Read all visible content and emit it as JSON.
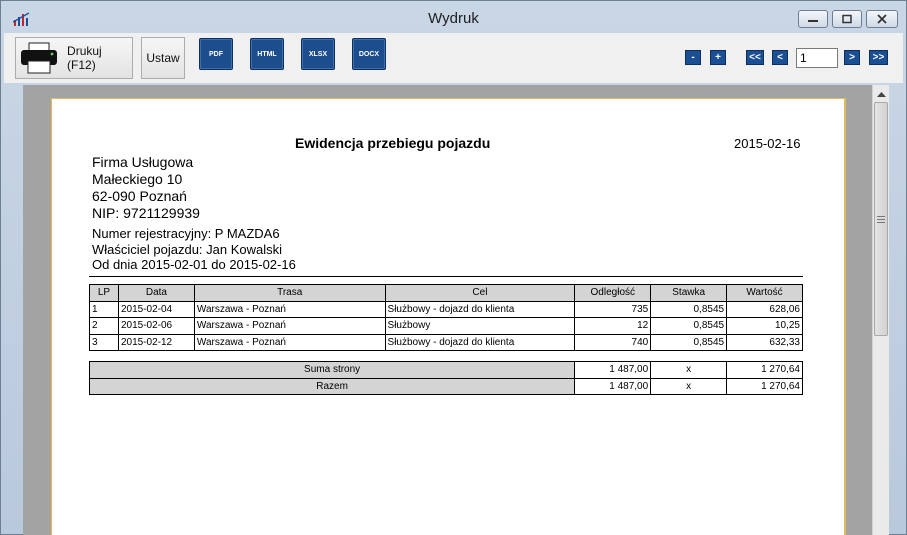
{
  "window": {
    "title": "Wydruk"
  },
  "toolbar": {
    "print_label": "Drukuj (F12)",
    "setup_label": "Ustaw",
    "exports": [
      "PDF",
      "HTML",
      "XLSX",
      "DOCX"
    ],
    "zoom_out": "-",
    "zoom_in": "+",
    "first_page": "<<",
    "prev_page": "<",
    "next_page": ">",
    "last_page": ">>",
    "page_value": "1"
  },
  "report": {
    "title": "Ewidencja przebiegu pojazdu",
    "date": "2015-02-16",
    "company": {
      "name": "Firma Usługowa",
      "street": "Małeckiego 10",
      "city": "62-090 Poznań",
      "nip": "NIP: 9721129939"
    },
    "vehicle": {
      "registration": "Numer rejestracyjny: P MAZDA6",
      "owner": "Właściciel pojazdu: Jan Kowalski",
      "period": "Od dnia 2015-02-01 do 2015-02-16"
    },
    "columns": [
      "LP",
      "Data",
      "Trasa",
      "Cel",
      "Odległość",
      "Stawka",
      "Wartość"
    ],
    "rows": [
      [
        "1",
        "2015-02-04",
        "Warszawa - Poznań",
        "Służbowy - dojazd do klienta",
        "735",
        "0,8545",
        "628,06"
      ],
      [
        "2",
        "2015-02-06",
        "Warszawa - Poznań",
        "Służbowy",
        "12",
        "0,8545",
        "10,25"
      ],
      [
        "3",
        "2015-02-12",
        "Warszawa - Poznań",
        "Służbowy - dojazd do klienta",
        "740",
        "0,8545",
        "632,33"
      ]
    ],
    "summary": [
      {
        "label": "Suma strony",
        "distance": "1 487,00",
        "rate": "x",
        "value": "1 270,64"
      },
      {
        "label": "Razem",
        "distance": "1 487,00",
        "rate": "x",
        "value": "1 270,64"
      }
    ]
  },
  "colors": {
    "export_button": "#1c4d8c",
    "page_border": "#e0bb5a",
    "viewer_bg": "#a3a3a3"
  }
}
